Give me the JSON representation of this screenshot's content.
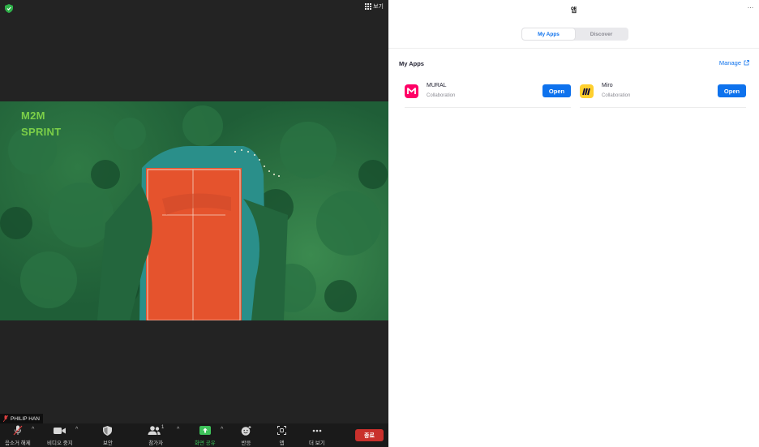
{
  "meeting": {
    "view_label": "보기",
    "slide": {
      "line1": "M2M",
      "line2": "SPRINT"
    },
    "participant_name": "PHILIP HAN"
  },
  "toolbar": {
    "unmute": "음소거 해제",
    "stop_video": "비디오 중지",
    "security": "보안",
    "participants": "참가자",
    "participants_count": "1",
    "share_screen": "화면 공유",
    "reactions": "반응",
    "apps": "앱",
    "more": "더 보기",
    "end": "종료"
  },
  "apps_panel": {
    "title": "앱",
    "tabs": [
      "My Apps",
      "Discover"
    ],
    "active_tab": "My Apps",
    "section_title": "My Apps",
    "manage_label": "Manage",
    "items": [
      {
        "name": "MURAL",
        "category": "Collaboration",
        "button": "Open",
        "logo_color": "#ff0066"
      },
      {
        "name": "Miro",
        "category": "Collaboration",
        "button": "Open",
        "logo_color": "#ffd02f"
      }
    ]
  },
  "colors": {
    "accent": "#0e72ed",
    "end_button": "#c9302c",
    "share_green": "#3ec15a",
    "slide_title": "#7ccf48"
  }
}
